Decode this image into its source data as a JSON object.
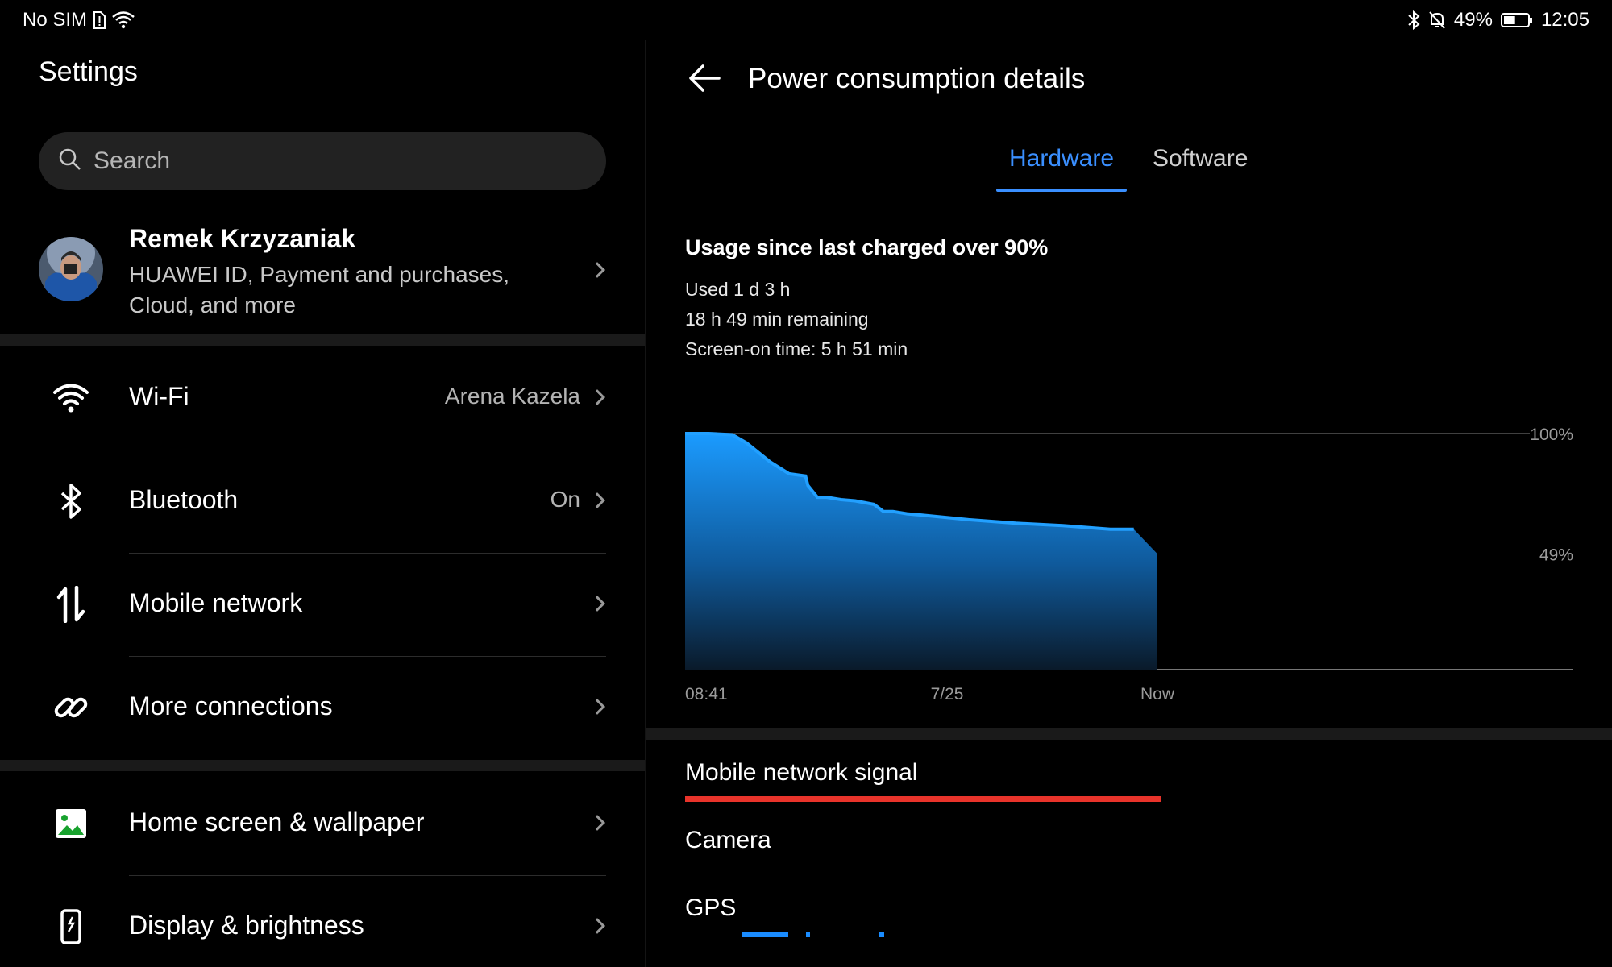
{
  "status_bar": {
    "carrier": "No SIM",
    "battery_percent": "49%",
    "battery_level": 0.49,
    "time": "12:05",
    "icons": [
      "sim-alert-icon",
      "wifi-icon",
      "bluetooth-icon",
      "mute-icon",
      "battery-icon"
    ]
  },
  "left": {
    "title": "Settings",
    "search_placeholder": "Search",
    "account": {
      "name": "Remek Krzyzaniak",
      "subtitle": "HUAWEI ID, Payment and purchases, Cloud, and more"
    },
    "items": [
      {
        "label": "Wi-Fi",
        "value": "Arena Kazela",
        "icon": "wifi-icon",
        "color": "#0c85d0"
      },
      {
        "label": "Bluetooth",
        "value": "On",
        "icon": "bluetooth-icon",
        "color": "#0c85d0"
      },
      {
        "label": "Mobile network",
        "value": "",
        "icon": "mobile-data-icon",
        "color": "#18a22e"
      },
      {
        "label": "More connections",
        "value": "",
        "icon": "link-icon",
        "color": "#c47f12"
      },
      {
        "label": "Home screen & wallpaper",
        "value": "",
        "icon": "wallpaper-icon",
        "color": "#18a22e"
      },
      {
        "label": "Display & brightness",
        "value": "",
        "icon": "display-icon",
        "color": "#18a22e"
      }
    ]
  },
  "right": {
    "title": "Power consumption details",
    "tabs": [
      "Hardware",
      "Software"
    ],
    "active_tab": "Hardware",
    "usage_title": "Usage since last charged over 90%",
    "used": "Used 1 d 3 h",
    "remaining": "18 h 49 min remaining",
    "screen_on": "Screen-on time: 5 h 51 min",
    "hardware": [
      {
        "name": "Mobile network signal",
        "color": "#e8332a"
      },
      {
        "name": "Camera",
        "color": ""
      },
      {
        "name": "GPS",
        "color": "#1a8cff"
      }
    ]
  },
  "chart_data": {
    "type": "area",
    "y_tick_labels": [
      "100%",
      "49%"
    ],
    "x_tick_labels": [
      "08:41",
      "7/25",
      "Now"
    ],
    "ylim": [
      0,
      100
    ],
    "x": [
      0,
      0.05,
      0.1,
      0.13,
      0.18,
      0.22,
      0.255,
      0.26,
      0.28,
      0.3,
      0.33,
      0.36,
      0.4,
      0.42,
      0.44,
      0.47,
      0.5,
      0.55,
      0.6,
      0.7,
      0.8,
      0.9,
      0.95,
      1.0
    ],
    "y": [
      100,
      100,
      99.5,
      96,
      88,
      83,
      82,
      78,
      73,
      73,
      72,
      71.5,
      70,
      67,
      67,
      66,
      65.5,
      64.5,
      63.5,
      62,
      61,
      59.5,
      59.5,
      49
    ],
    "legend": "none",
    "grid": false
  }
}
